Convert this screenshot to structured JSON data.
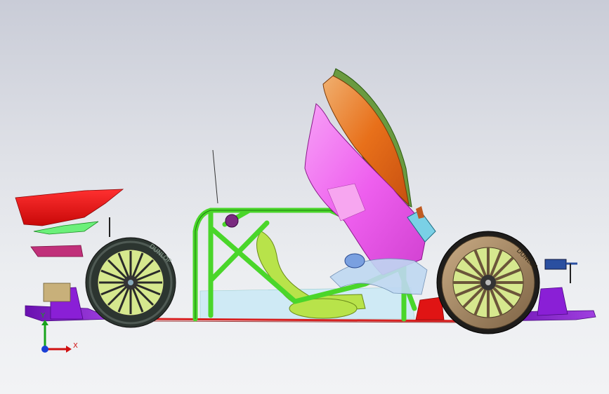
{
  "viewport": {
    "background_colors": [
      "#c9ccd7",
      "#f2f3f5"
    ]
  },
  "triad": {
    "x_label": "X",
    "y_label": "Y",
    "x_color": "#d01010",
    "y_color": "#17a31b",
    "z_color": "#1a3fd6"
  },
  "model": {
    "colors": {
      "roll_cage": "#4ad62a",
      "canopy_magenta": "#f06ff0",
      "canopy_orange": "#e8701a",
      "front_wing": "#e01414",
      "side_skirt_purple": "#8a1fd6",
      "chassis_line": "#d82020",
      "floor_panel": "#cfeaf5",
      "seat": "#b8e34a",
      "tire": "#2c3530",
      "rear_rim": "#a98760",
      "front_rim": "#d6e88e",
      "mirror": "#2a4fa0"
    },
    "tire_texts": {
      "rear": "DUNLOP",
      "front": "DUNLOP"
    }
  }
}
